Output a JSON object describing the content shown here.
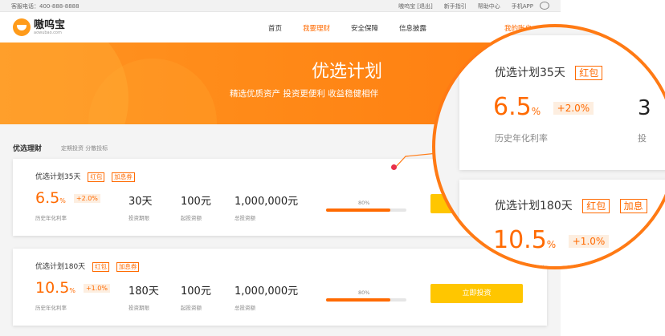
{
  "topbar": {
    "hotline": "客服电话：400-888-8888",
    "links": [
      "嗷呜宝 [退出]",
      "新手指引",
      "帮助中心",
      "手机APP"
    ]
  },
  "header": {
    "logo_text": "嗷呜宝",
    "logo_sub": "aowubao.com",
    "nav": [
      "首页",
      "我要理财",
      "安全保障",
      "信息披露"
    ],
    "account": "我的账户"
  },
  "banner": {
    "title": "优选计划",
    "subtitle": "精选优质资产 投资更便利 收益稳健相伴"
  },
  "section": {
    "title": "优选理财",
    "subtitle": "定期投资 分散投标"
  },
  "products": [
    {
      "name": "优选计划35天",
      "tags": [
        "红包",
        "加息券"
      ],
      "rate": "6.5",
      "rate_unit": "%",
      "bonus": "+2.0%",
      "rate_label": "历史年化利率",
      "term": "30天",
      "term_label": "投资期限",
      "min": "100元",
      "min_label": "起投资额",
      "total": "1,000,000元",
      "total_label": "总投资额",
      "progress": 0.8,
      "progress_label": "80%",
      "button": ""
    },
    {
      "name": "优选计划180天",
      "tags": [
        "红包",
        "加息券"
      ],
      "rate": "10.5",
      "rate_unit": "%",
      "bonus": "+1.0%",
      "rate_label": "历史年化利率",
      "term": "180天",
      "term_label": "投资期限",
      "min": "100元",
      "min_label": "起投资额",
      "total": "1,000,000元",
      "total_label": "总投资额",
      "progress": 0.8,
      "progress_label": "80%",
      "button": "立即投资"
    }
  ],
  "magnifier": {
    "card1": {
      "name": "优选计划35天",
      "tag": "红包",
      "rate": "6.5",
      "unit": "%",
      "bonus": "+2.0%",
      "label": "历史年化利率",
      "cut_val": "3",
      "cut_lbl": "投"
    },
    "card2": {
      "name": "优选计划180天",
      "tags": [
        "红包",
        "加息"
      ],
      "rate": "10.5",
      "unit": "%",
      "bonus": "+1.0%",
      "label": "历史年化利率"
    }
  },
  "colors": {
    "accent": "#ff6a00",
    "button": "#ffc600",
    "banner": "#ff8a18"
  }
}
